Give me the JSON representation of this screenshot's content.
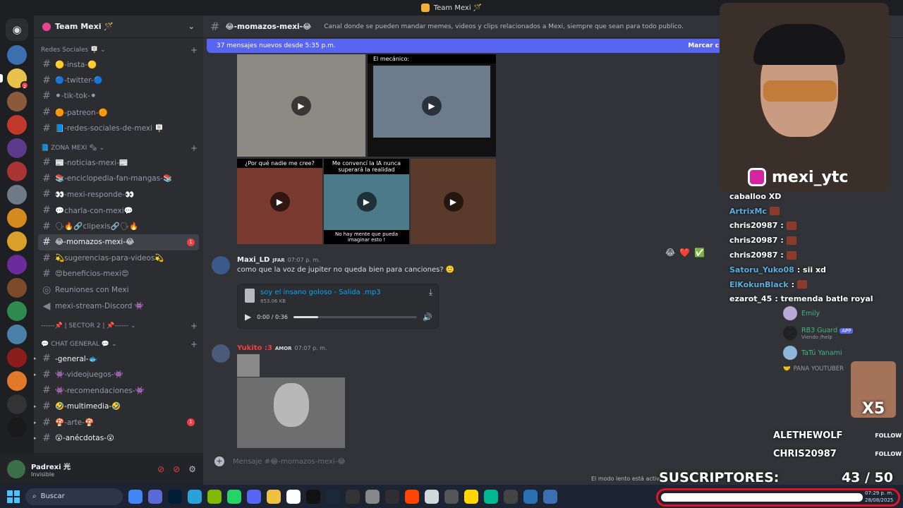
{
  "window": {
    "title": "Team Mexi 🪄"
  },
  "server": {
    "name": "Team Mexi 🪄"
  },
  "categories": [
    {
      "label": "Redes Sociales 🪧",
      "channels": [
        {
          "name": "🟡-insta-🟡",
          "unread": false
        },
        {
          "name": "🔵-twitter-🔵",
          "unread": false
        },
        {
          "name": "⚫-tik-tok-⚫",
          "unread": false
        },
        {
          "name": "🟠-patreon-🟠",
          "unread": false
        },
        {
          "name": "📘-redes-sociales-de-mexi 🪧",
          "unread": false
        }
      ]
    },
    {
      "label": "📘 ZONA MEXI 🗞",
      "channels": [
        {
          "name": "📰-noticias-mexi-📰"
        },
        {
          "name": "📚-enciclopedia-fan-mangas-📚"
        },
        {
          "name": "👀-mexi-responde-👀"
        },
        {
          "name": "💬charla-con-mexi💬"
        },
        {
          "name": "🗣🔥🔗clipexis🔗🗣🔥"
        },
        {
          "name": "😂-momazos-mexi-😂",
          "active": true,
          "badge": "1"
        },
        {
          "name": "💫sugerencias-para-videos💫"
        },
        {
          "name": "😍beneficios-mexi😍"
        },
        {
          "name": "Reuniones con Mexi",
          "type": "stage"
        },
        {
          "name": "mexi-stream-Discord 👾",
          "type": "voice"
        }
      ]
    },
    {
      "label": "------📌 | SECTOR 2 | 📌------",
      "channels": []
    },
    {
      "label": "💬 CHAT GENERAL 💬",
      "channels": [
        {
          "name": "-general-🐟",
          "bold": true
        },
        {
          "name": "👾-videojuegos-👾"
        },
        {
          "name": "👾-recomendaciones-👾"
        },
        {
          "name": "🤣-multimedia-🤣",
          "bold": true
        },
        {
          "name": "🍄-arte-🍄",
          "badge": "1"
        },
        {
          "name": "😮-anécdotas-😮",
          "bold": true
        }
      ]
    }
  ],
  "user": {
    "name": "Padrexi 光",
    "status": "Invisible"
  },
  "channel_header": {
    "name": "😂-momazos-mexi-😂",
    "topic": "Canal donde se pueden mandar memes, videos y clips relacionados a Mexi, siempre que sean para todo publico."
  },
  "new_messages_bar": {
    "text": "37 mensajes nuevos desde 5:35 p.m.",
    "action": "Marcar c"
  },
  "media": {
    "mechanic_caption": "El mecánico:",
    "clip3_caption": "¿Por qué nadie me cree?",
    "clip4_caption": "Me convencí la IA nunca superará la realidad",
    "clip4_bottom": "No hay mente que pueda imaginar esto !"
  },
  "messages": [
    {
      "author": "Maxi_LD",
      "tag": "JFAR",
      "time": "07:07 p. m.",
      "text": "como que la voz de jupiter no queda bien para canciones? 🙂",
      "attachment": {
        "filename": "soy el insano goloso - Salida .mp3",
        "size": "853.06 KB",
        "time": "0:00 / 0:36",
        "progress": 0.2
      }
    },
    {
      "author": "Yukito :3",
      "tag": "AMOR",
      "time": "07:07 p. m."
    }
  ],
  "reactions": [
    "😂",
    "❤️",
    "✅"
  ],
  "composer": {
    "placeholder": "Mensaje #😂-momazos-mexi-😂",
    "slow_mode": "El modo lento está activ"
  },
  "stream": {
    "instagram_handle": "mexi_ytc",
    "chat": [
      {
        "user": "caballoo XD",
        "text": ""
      },
      {
        "user": "ArtrixMc",
        "text": ""
      },
      {
        "user": "chris20987",
        "text": ":"
      },
      {
        "user": "chris20987",
        "text": ":"
      },
      {
        "user": "chris20987",
        "text": ":"
      },
      {
        "user": "Satoru_Yuko08",
        "text": ": sii xd"
      },
      {
        "user": "ElKokunBlack",
        "text": ":"
      },
      {
        "user": "ezarot_45",
        "text": ": tremenda batle royal"
      }
    ],
    "follows": [
      {
        "name": "ALETHEWOLF",
        "tag": "FOLLOW"
      },
      {
        "name": "CHRIS20987",
        "tag": "FOLLOW"
      }
    ],
    "subs": {
      "label": "SUSCRIPTORES:",
      "value": "43 / 50",
      "fraction": 0.86
    },
    "laugh_multiplier": "X5"
  },
  "members": [
    {
      "name": "Emily",
      "sub": ""
    },
    {
      "name": "RB3 Guard",
      "sub": "Viendo /help",
      "app": "APP"
    },
    {
      "name": "TaTú Yanami",
      "sub": ""
    }
  ],
  "member_category": "PANA YOUTUBER",
  "taskbar": {
    "search": "Buscar",
    "time": "07:29 p. m.",
    "date": "28/08/2025"
  }
}
